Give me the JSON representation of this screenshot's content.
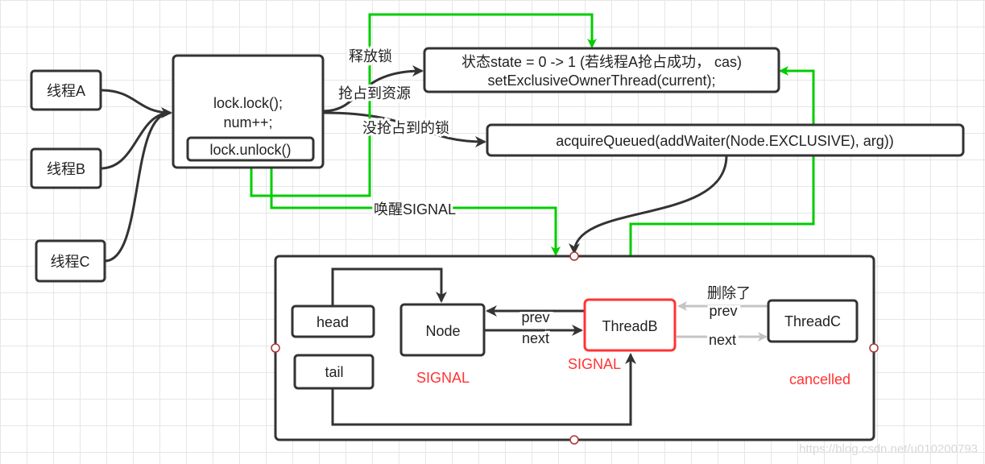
{
  "threads": [
    "线程A",
    "线程B",
    "线程C"
  ],
  "lock_box": {
    "line1": "lock.lock();",
    "line2": "num++;",
    "unlock": "lock.unlock()"
  },
  "state_box": {
    "line1": "状态state = 0 -> 1 (若线程A抢占成功， cas)",
    "line2": "setExclusiveOwnerThread(current);"
  },
  "acquire_box": "acquireQueued(addWaiter(Node.EXCLUSIVE), arg))",
  "edge_labels": {
    "release": "释放锁",
    "acquired": "抢占到资源",
    "not_acquired": "没抢占到的锁",
    "wake": "唤醒SIGNAL"
  },
  "queue": {
    "head": "head",
    "tail": "tail",
    "node": "Node",
    "thread_b": "ThreadB",
    "thread_c": "ThreadC",
    "prev": "prev",
    "next": "next",
    "deleted": "删除了",
    "prev_c": "prev",
    "next_c": "next",
    "node_status": "SIGNAL",
    "thread_b_status": "SIGNAL",
    "thread_c_status": "cancelled"
  },
  "colors": {
    "signal_edge": "#00cc00",
    "status_text": "#ff3333",
    "removed_edge": "#c4c4c4"
  },
  "watermark": "https://blog.csdn.net/u010200793"
}
